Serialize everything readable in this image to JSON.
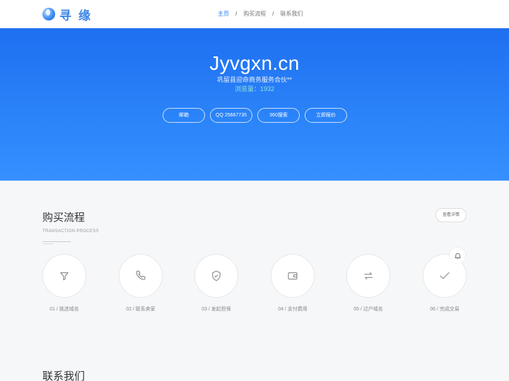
{
  "header": {
    "logo_text": "寻缘",
    "nav": [
      {
        "label": "主页"
      },
      {
        "label": "购买流程"
      },
      {
        "label": "联系我们"
      }
    ],
    "separator": "/"
  },
  "hero": {
    "title": "Jyvgxn.cn",
    "subtitle": "巩留县迎命商务服务合伙**",
    "views": "浏览量：1932",
    "buttons": [
      {
        "label": "邮箱"
      },
      {
        "label": "QQ 25667735"
      },
      {
        "label": "360搜索"
      },
      {
        "label": "立即报价"
      }
    ]
  },
  "process": {
    "title": "购买流程",
    "subtitle": "TRANSACTION PROCESS",
    "detail_button": "查看详情",
    "steps": [
      {
        "label": "01 / 挑选域名",
        "icon": "filter-icon"
      },
      {
        "label": "02 / 联系卖家",
        "icon": "phone-icon"
      },
      {
        "label": "03 / 发起担保",
        "icon": "shield-check-icon"
      },
      {
        "label": "04 / 支付费用",
        "icon": "wallet-icon"
      },
      {
        "label": "05 / 过户域名",
        "icon": "transfer-icon"
      },
      {
        "label": "06 / 完成交易",
        "icon": "check-icon"
      }
    ]
  },
  "contact": {
    "title": "联系我们"
  },
  "colors": {
    "accent": "#2f80ed",
    "hero_top": "#1f6ff0",
    "hero_bottom": "#3690ff",
    "views_text": "#8fe0d8"
  }
}
